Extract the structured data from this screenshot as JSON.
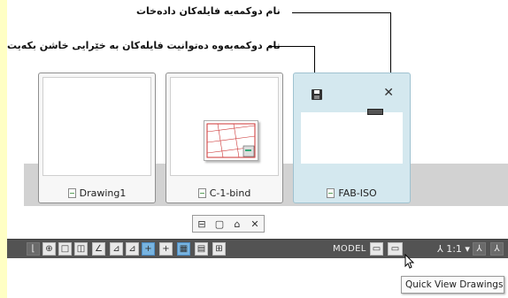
{
  "annotations": {
    "close_callout": "نام دوکمەیە فایلەکان دادەخات",
    "save_callout": "نام دوکمەیەوە دەتوانیت فایلەکان بە خێرایی خاشن بکەیت"
  },
  "drawings": [
    {
      "label": "Drawing1",
      "active": false
    },
    {
      "label": "C-1-bind",
      "active": false
    },
    {
      "label": "FAB-ISO",
      "active": true
    }
  ],
  "active_card": {
    "save_icon": "save-icon",
    "close_glyph": "✕"
  },
  "mini_toolbar": {
    "items": [
      {
        "icon": "pin-icon",
        "glyph": "⊟"
      },
      {
        "icon": "new-drawing-icon",
        "glyph": "▢"
      },
      {
        "icon": "open-folder-icon",
        "glyph": "⌂"
      },
      {
        "icon": "close-icon",
        "glyph": "✕"
      }
    ]
  },
  "status_bar": {
    "model_label": "MODEL",
    "scale_label": "⅄ 1:1 ▾",
    "quick_view_drawings_icon": "quick-view-drawings-icon"
  },
  "tooltip": {
    "text": "Quick View Drawings"
  },
  "colors": {
    "active_card_bg": "#d4e8ef",
    "status_bar_bg": "#535353",
    "annotation_strip": "#ffffc4"
  }
}
